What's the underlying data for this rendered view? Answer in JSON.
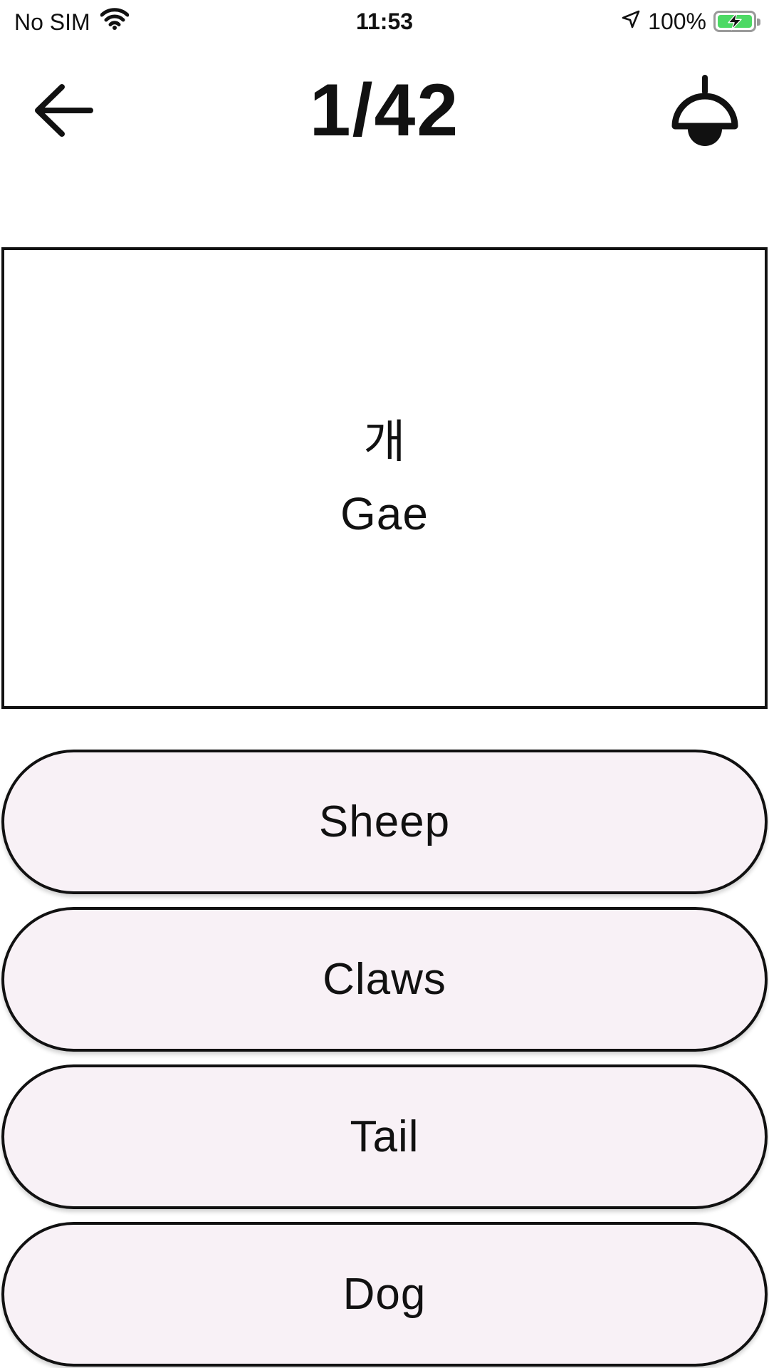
{
  "status_bar": {
    "carrier": "No SIM",
    "time": "11:53",
    "battery_percent": "100%",
    "battery_level": 1.0,
    "battery_color": "#4cd964",
    "icons": [
      "wifi-icon",
      "location-arrow-icon",
      "battery-charging-icon"
    ]
  },
  "header": {
    "counter": "1/42",
    "back_icon": "arrow-left-icon",
    "lamp_icon": "pendant-lamp-icon"
  },
  "card": {
    "word": "개",
    "romanization": "Gae"
  },
  "answers": [
    {
      "label": "Sheep"
    },
    {
      "label": "Claws"
    },
    {
      "label": "Tail"
    },
    {
      "label": "Dog"
    }
  ],
  "colors": {
    "answer_background": "#f8f1f6",
    "border": "#111111"
  }
}
